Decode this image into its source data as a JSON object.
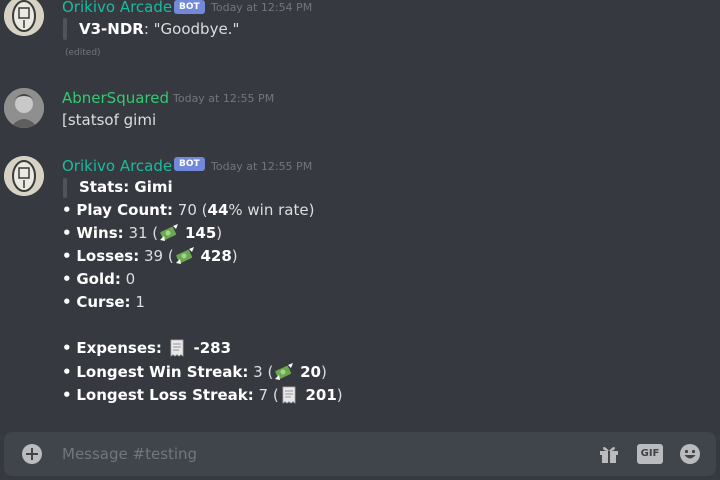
{
  "messages": [
    {
      "author": "Orikivo Arcade",
      "tag": "BOT",
      "timestamp": "Today at 12:54 PM",
      "quote_speaker": "V3-NDR",
      "quote_text": ": \"Goodbye.\"",
      "edited": "(edited)"
    },
    {
      "author": "AbnerSquared",
      "timestamp": "Today at 12:55 PM",
      "content": "[statsof gimi"
    },
    {
      "author": "Orikivo Arcade",
      "tag": "BOT",
      "timestamp": "Today at 12:55 PM",
      "stats_title": "Stats: Gimi",
      "bullet": "•",
      "play_count_label": "Play Count:",
      "play_count_value": "70 (",
      "win_rate_pct": "44",
      "win_rate_suffix": "% win rate)",
      "wins_label": "Wins:",
      "wins_value": "31 (",
      "wins_amount": "145",
      "losses_label": "Losses:",
      "losses_value": "39 (",
      "losses_amount": "428",
      "gold_label": "Gold:",
      "gold_value": "0",
      "curse_label": "Curse:",
      "curse_value": "1",
      "expenses_label": "Expenses:",
      "expenses_amount": "-283",
      "win_streak_label": "Longest Win Streak:",
      "win_streak_value": "3 (",
      "win_streak_amount": "20",
      "loss_streak_label": "Longest Loss Streak:",
      "loss_streak_value": "7 (",
      "loss_streak_amount": "201",
      "close_paren": ")"
    }
  ],
  "composer": {
    "placeholder": "Message #testing",
    "gif_label": "GIF"
  },
  "icons": {
    "money": "money-with-wings-icon",
    "receipt": "receipt-icon",
    "gift": "gift-icon",
    "emoji": "emoji-smile-icon",
    "add": "add-circle-icon"
  }
}
